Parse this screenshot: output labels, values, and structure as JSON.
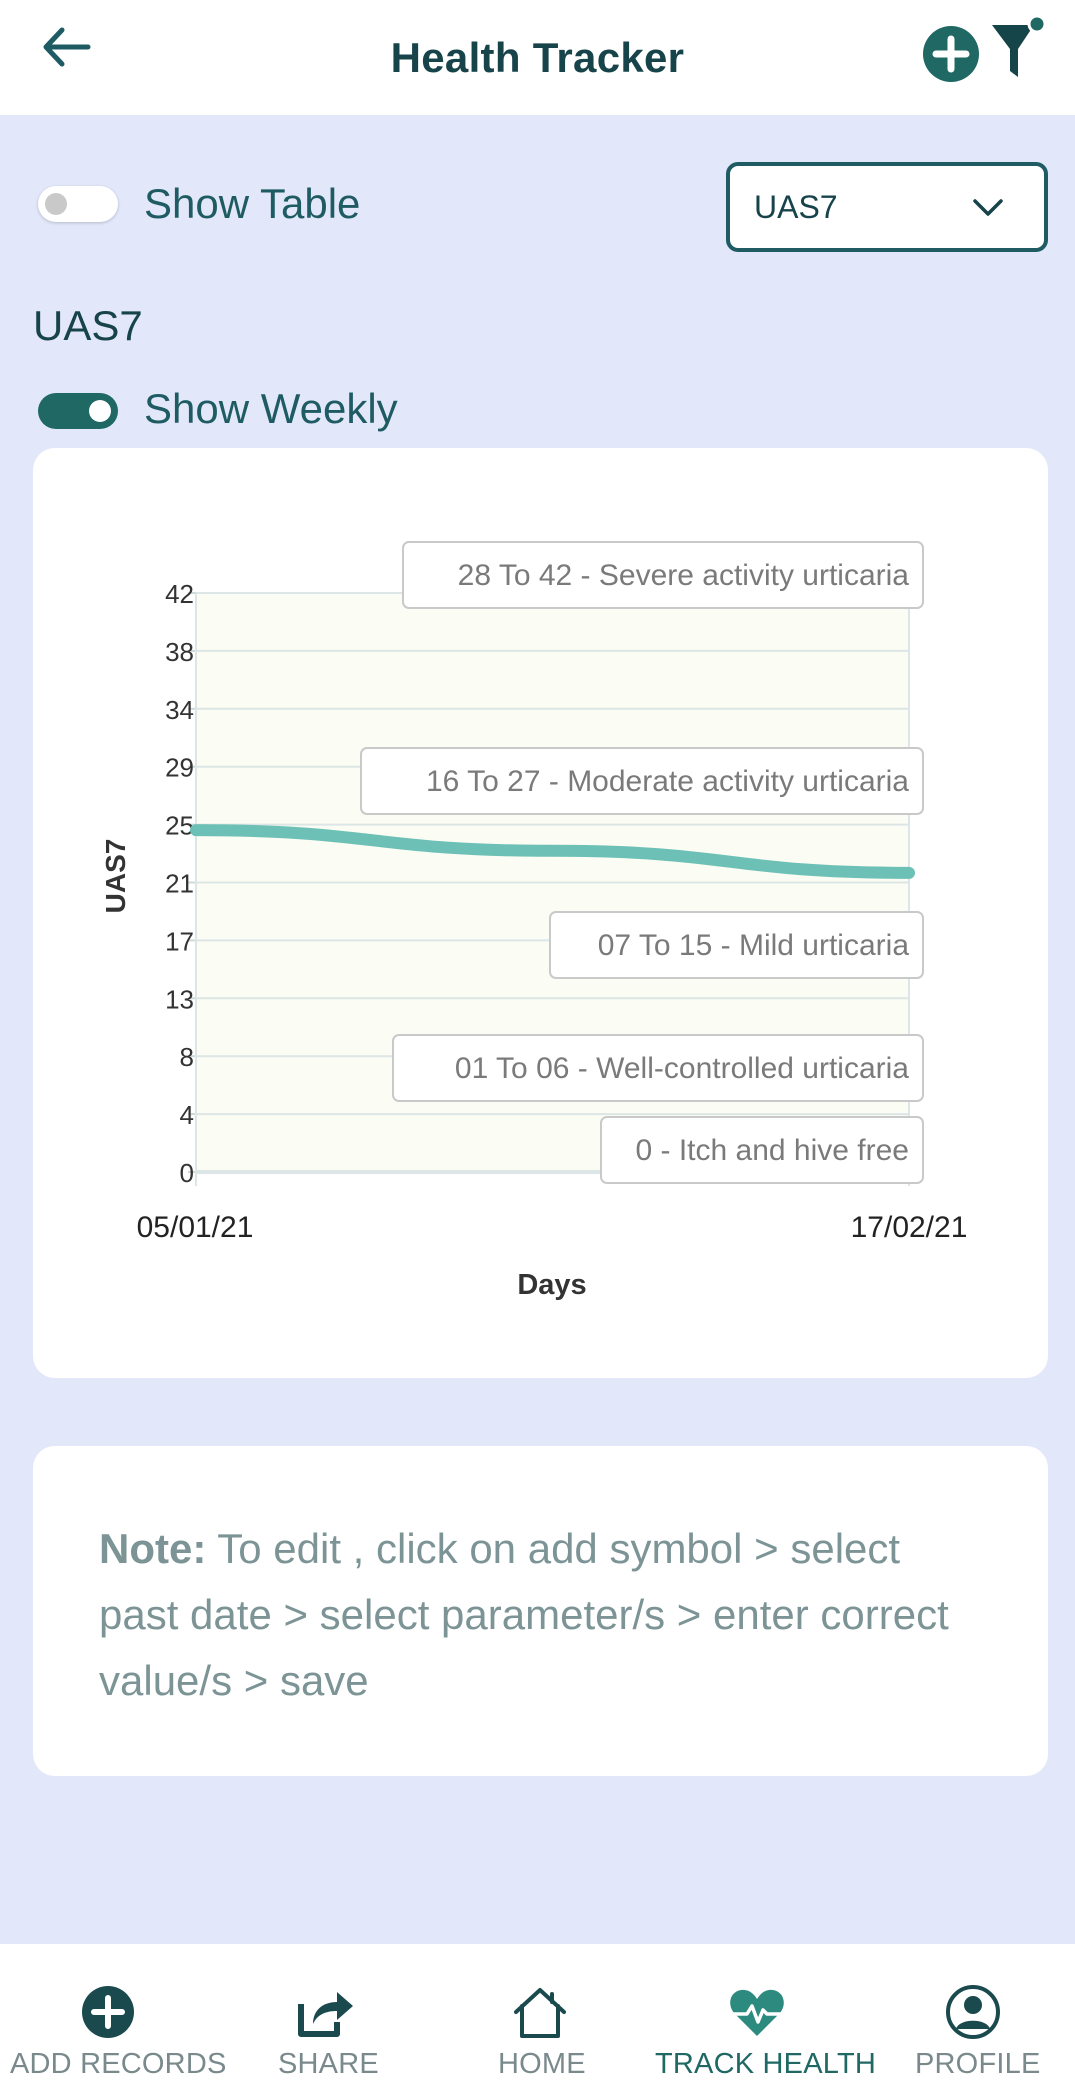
{
  "header": {
    "title": "Health Tracker"
  },
  "controls": {
    "show_table_label": "Show Table",
    "show_table_on": false,
    "parameter_select_value": "UAS7",
    "show_weekly_label": "Show Weekly",
    "show_weekly_on": true
  },
  "section_title": "UAS7",
  "chart_data": {
    "type": "line",
    "ylabel": "UAS7",
    "xlabel": "Days",
    "x": [
      "05/01/21",
      "17/02/21"
    ],
    "y_ticks": [
      "0",
      "4",
      "8",
      "13",
      "17",
      "21",
      "25",
      "29",
      "34",
      "38",
      "42"
    ],
    "ylim": [
      0,
      42
    ],
    "series": [
      {
        "values": [
          24.8,
          23.3,
          21.7
        ]
      }
    ],
    "bands": [
      {
        "label": "28 To 42 - Severe activity urticaria"
      },
      {
        "label": "16 To 27 - Moderate activity urticaria"
      },
      {
        "label": "07 To 15 - Mild urticaria"
      },
      {
        "label": "01 To 06 - Well-controlled urticaria"
      },
      {
        "label": "0 - Itch and hive free"
      }
    ],
    "colors": {
      "line": "#6cc0b6",
      "plot_bg": "#fbfcf3",
      "grid": "#dde6e6"
    }
  },
  "note": {
    "prefix": "Note:",
    "text": " To edit , click on add symbol > select past date > select parameter/s > enter correct value/s > save"
  },
  "bottom_nav": {
    "items": [
      {
        "label": "ADD RECORDS",
        "icon": "add-circle-icon",
        "active": false
      },
      {
        "label": "SHARE",
        "icon": "share-icon",
        "active": false
      },
      {
        "label": "HOME",
        "icon": "home-icon",
        "active": false
      },
      {
        "label": "TRACK HEALTH",
        "icon": "heart-pulse-icon",
        "active": true
      },
      {
        "label": "PROFILE",
        "icon": "profile-icon",
        "active": false
      }
    ]
  },
  "colors": {
    "accent": "#1f6864",
    "dark_text": "#17434a",
    "page_bg": "#e2e8fa"
  }
}
